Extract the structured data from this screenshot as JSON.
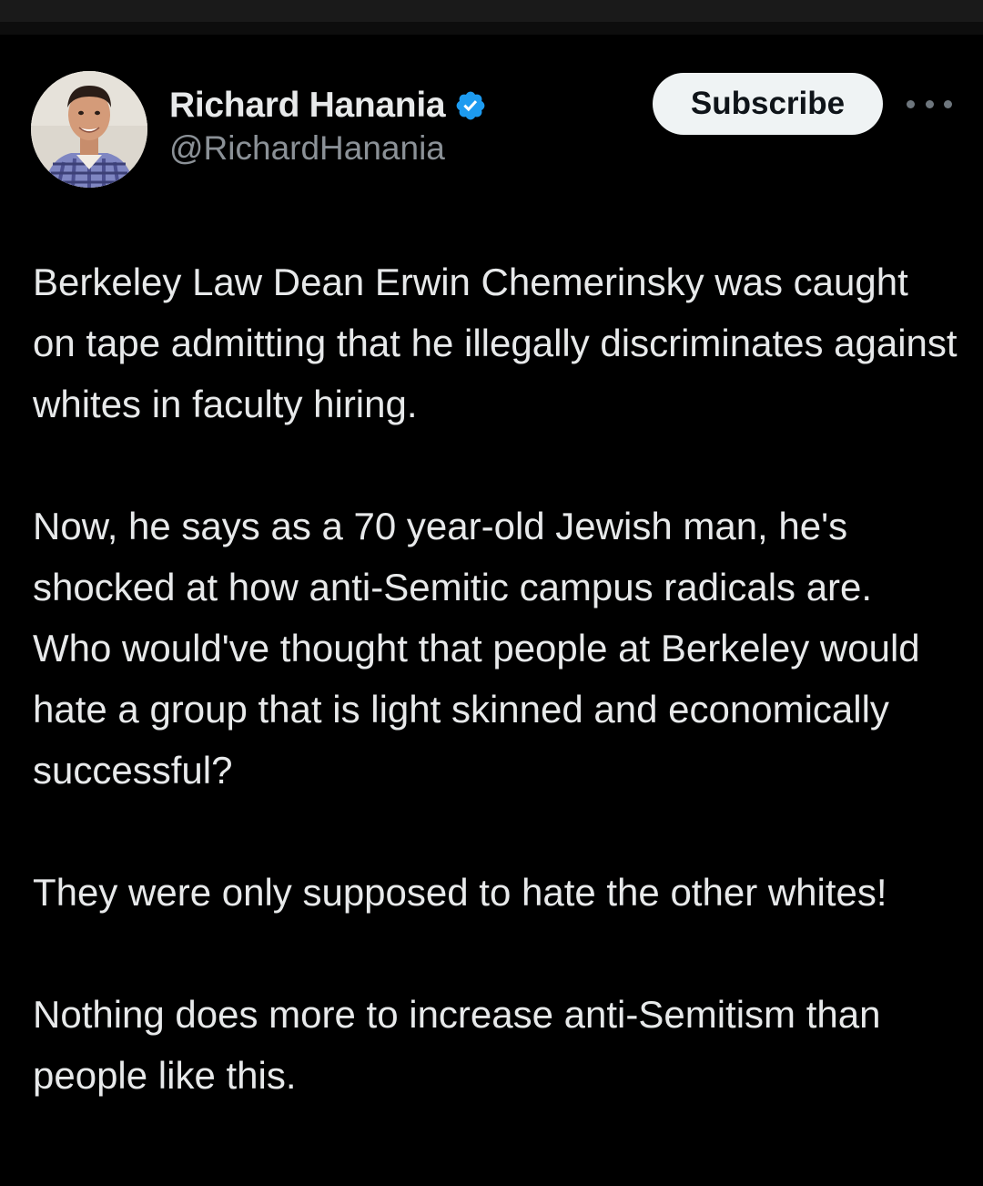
{
  "author": {
    "display_name": "Richard Hanania",
    "handle": "@RichardHanania",
    "verified_icon": "verified-badge-icon"
  },
  "actions": {
    "subscribe_label": "Subscribe",
    "more_icon": "more-options-icon"
  },
  "tweet": {
    "paragraphs": [
      "Berkeley Law Dean Erwin Chemerinsky was caught on tape admitting that he illegally discriminates against whites in faculty hiring.",
      "Now, he says as a 70 year-old Jewish man, he's shocked at how anti-Semitic campus radicals are. Who would've thought that people at Berkeley would hate a group that is light skinned and economically successful?",
      "They were only supposed to hate the other whites!",
      "Nothing does more to increase anti-Semitism than people like this."
    ]
  },
  "colors": {
    "background": "#000000",
    "text_primary": "#e7e9ea",
    "text_secondary": "#8b9197",
    "verified_blue": "#1d9bf0",
    "button_bg": "#eff3f4"
  }
}
